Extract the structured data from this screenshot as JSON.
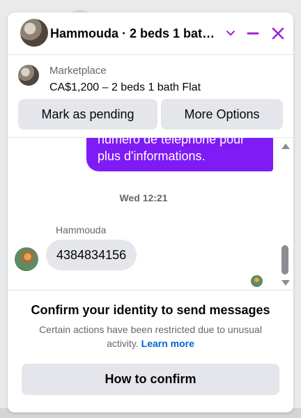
{
  "header": {
    "title": "Hammouda · 2 beds 1 bath Flat",
    "accent_color": "#a11fd4",
    "icons": [
      "chevron-down-icon",
      "minimize-icon",
      "close-icon"
    ]
  },
  "listing": {
    "label": "Marketplace",
    "price_line": "CA$1,200 – 2 beds 1 bath Flat",
    "mark_pending_label": "Mark as pending",
    "more_options_label": "More Options"
  },
  "messages": {
    "outgoing_text": "numéro de téléphone pour plus d'informations.",
    "outgoing_color": "#7f1bf5",
    "timestamp": "Wed 12:21",
    "sender_name": "Hammouda",
    "incoming_text": "4384834156"
  },
  "restriction": {
    "title": "Confirm your identity to send messages",
    "text": "Certain actions have been restricted due to unusual activity.",
    "learn_more": "Learn more",
    "confirm_label": "How to confirm"
  }
}
